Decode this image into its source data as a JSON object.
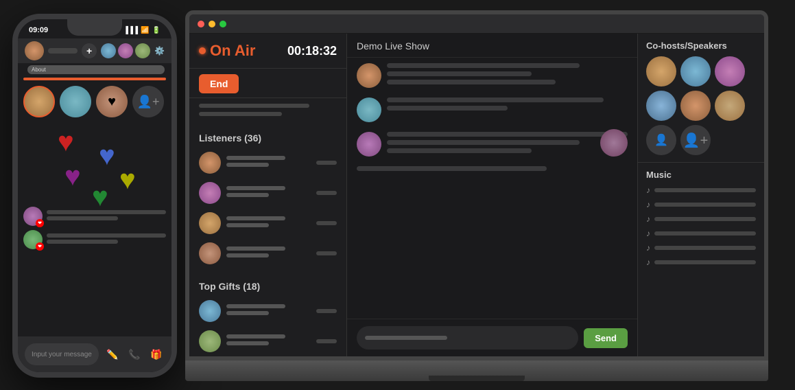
{
  "phone": {
    "status_time": "09:09",
    "header": {
      "add_label": "+",
      "about_label": "About"
    },
    "bottom_bar": {
      "input_placeholder": "Input your message"
    }
  },
  "laptop": {
    "titlebar": {
      "dots": [
        "red",
        "yellow",
        "green"
      ]
    },
    "on_air": {
      "label": "On Air",
      "timer": "00:18:32",
      "end_button": "End"
    },
    "listeners": {
      "title": "Listeners (36)"
    },
    "top_gifts": {
      "title": "Top Gifts (18)"
    },
    "show_title": "Demo Live Show",
    "chat": {
      "send_button": "Send",
      "input_placeholder": ""
    },
    "cohosts": {
      "title": "Co-hosts/Speakers"
    },
    "music": {
      "title": "Music",
      "tracks": [
        "",
        "",
        "",
        "",
        "",
        ""
      ]
    }
  }
}
